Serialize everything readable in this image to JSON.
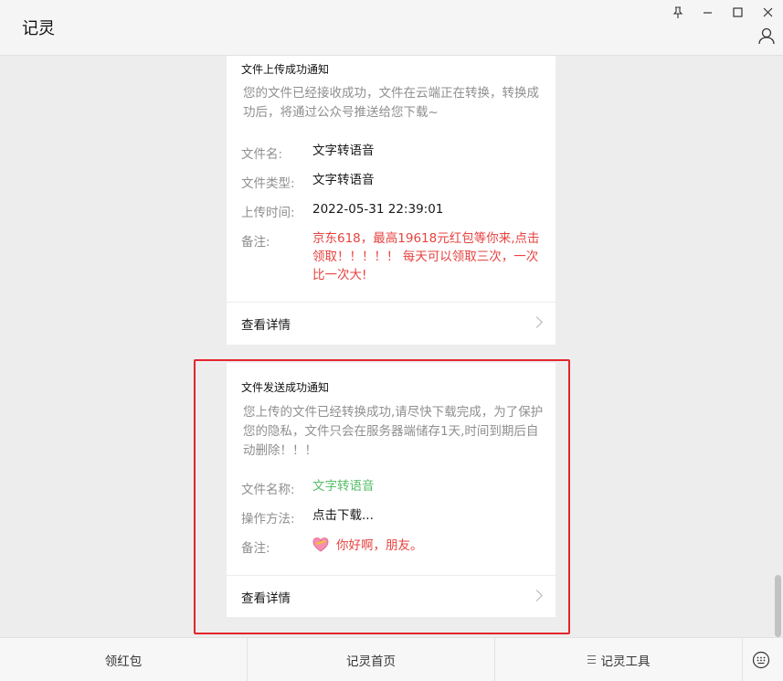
{
  "app": {
    "title": "记灵"
  },
  "window_controls": {
    "pin": "⊥",
    "minimize": "—",
    "maximize": "☐",
    "close": "✕"
  },
  "cards": [
    {
      "title": "文件上传成功通知",
      "description": "您的文件已经接收成功，文件在云端正在转换，转换成功后，将通过公众号推送给您下载~",
      "fields": [
        {
          "label": "文件名:",
          "value": "文字转语音"
        },
        {
          "label": "文件类型:",
          "value": "文字转语音"
        },
        {
          "label": "上传时间:",
          "value": "2022-05-31 22:39:01"
        },
        {
          "label": "备注:",
          "value": "京东618，最高19618元红包等你来,点击领取！！！！！ 每天可以领取三次，一次比一次大!"
        }
      ],
      "detail_label": "查看详情"
    },
    {
      "title": "文件发送成功通知",
      "description": "您上传的文件已经转换成功,请尽快下载完成，为了保护您的隐私，文件只会在服务器端储存1天,时间到期后自动删除！！！",
      "fields": [
        {
          "label": "文件名称:",
          "value": "文字转语音"
        },
        {
          "label": "操作方法:",
          "value": "点击下载..."
        },
        {
          "label": "备注:",
          "value": "你好啊，朋友。"
        }
      ],
      "detail_label": "查看详情"
    }
  ],
  "bottom_tabs": [
    {
      "label": "领红包"
    },
    {
      "label": "记灵首页"
    },
    {
      "label": "记灵工具"
    }
  ],
  "colors": {
    "red_value": "#e64340",
    "green_value": "#58be6a",
    "highlight_border": "#e4252d"
  },
  "icons": [
    "pin-icon",
    "minimize-icon",
    "maximize-icon",
    "close-icon",
    "user-icon",
    "chevron-right-icon",
    "heart-emoji-icon",
    "menu-icon",
    "keyboard-icon"
  ]
}
